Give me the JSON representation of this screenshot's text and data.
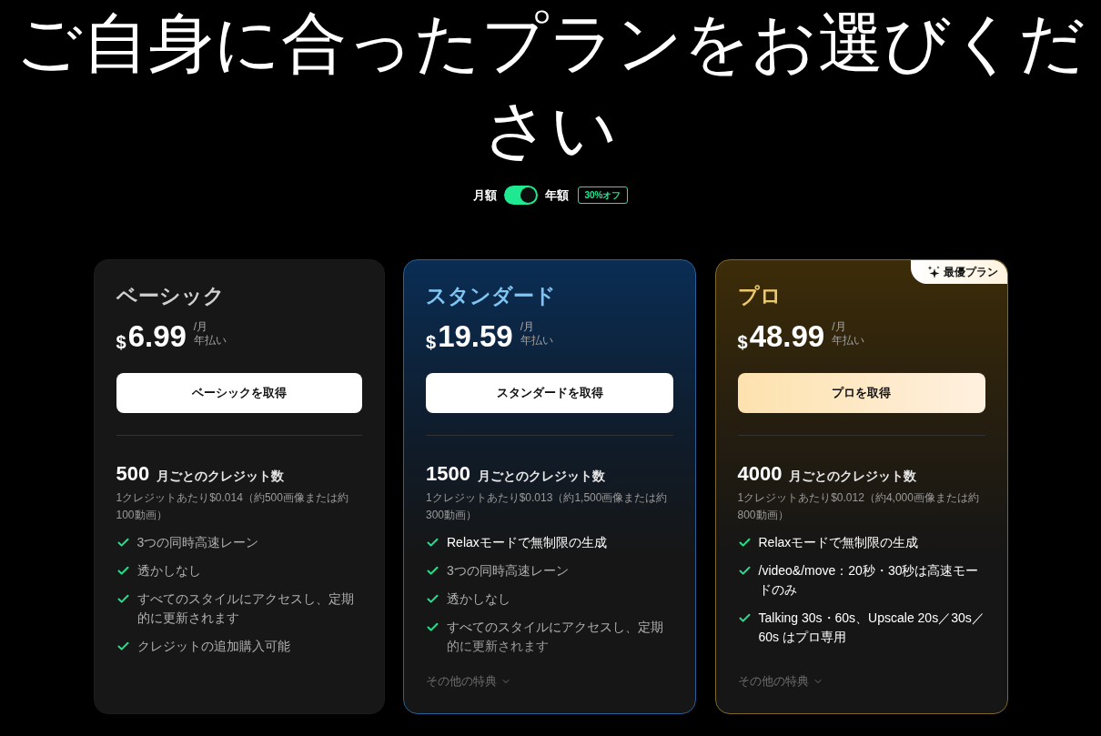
{
  "title": "ご自身に合ったプランをお選びください",
  "billing": {
    "monthly_label": "月額",
    "annual": true,
    "annual_label": "年額",
    "discount": "30%オフ"
  },
  "plans": [
    {
      "kind": "plain",
      "name": "ベーシック",
      "price": {
        "currency": "$",
        "amount": "6.99",
        "period": "/月",
        "billing": "年払い"
      },
      "button": "ベーシックを取得",
      "credits": {
        "amount": "500",
        "label": "月ごとのクレジット数",
        "detail": "1クレジットあたり$0.014（約500画像または約100動画）"
      },
      "features": [
        {
          "text": "3つの同時高速レーン",
          "highlighted": false
        },
        {
          "text": "透かしなし",
          "highlighted": false
        },
        {
          "text": "すべてのスタイルにアクセスし、定期的に更新されます",
          "highlighted": false
        },
        {
          "text": "クレジットの追加購入可能",
          "highlighted": false
        }
      ]
    },
    {
      "kind": "blue",
      "name": "スタンダード",
      "price": {
        "currency": "$",
        "amount": "19.59",
        "period": "/月",
        "billing": "年払い"
      },
      "button": "スタンダードを取得",
      "credits": {
        "amount": "1500",
        "label": "月ごとのクレジット数",
        "detail": "1クレジットあたり$0.013（約1,500画像または約300動画）"
      },
      "features": [
        {
          "text": "Relaxモードで無制限の生成",
          "highlighted": true
        },
        {
          "text": "3つの同時高速レーン",
          "highlighted": false
        },
        {
          "text": "透かしなし",
          "highlighted": false
        },
        {
          "text": "すべてのスタイルにアクセスし、定期的に更新されます",
          "highlighted": false
        }
      ],
      "more_link": "その他の特典"
    },
    {
      "kind": "gold",
      "badge": "最優プラン",
      "name": "プロ",
      "price": {
        "currency": "$",
        "amount": "48.99",
        "period": "/月",
        "billing": "年払い"
      },
      "button": "プロを取得",
      "credits": {
        "amount": "4000",
        "label": "月ごとのクレジット数",
        "detail": "1クレジットあたり$0.012（約4,000画像または約800動画）"
      },
      "features": [
        {
          "text": "Relaxモードで無制限の生成",
          "highlighted": true
        },
        {
          "text": "/video&/move：20秒・30秒は高速モードのみ",
          "highlighted": true
        },
        {
          "text": "Talking 30s・60s、Upscale 20s／30s／60s はプロ専用",
          "highlighted": true
        }
      ],
      "more_link": "その他の特典"
    }
  ]
}
